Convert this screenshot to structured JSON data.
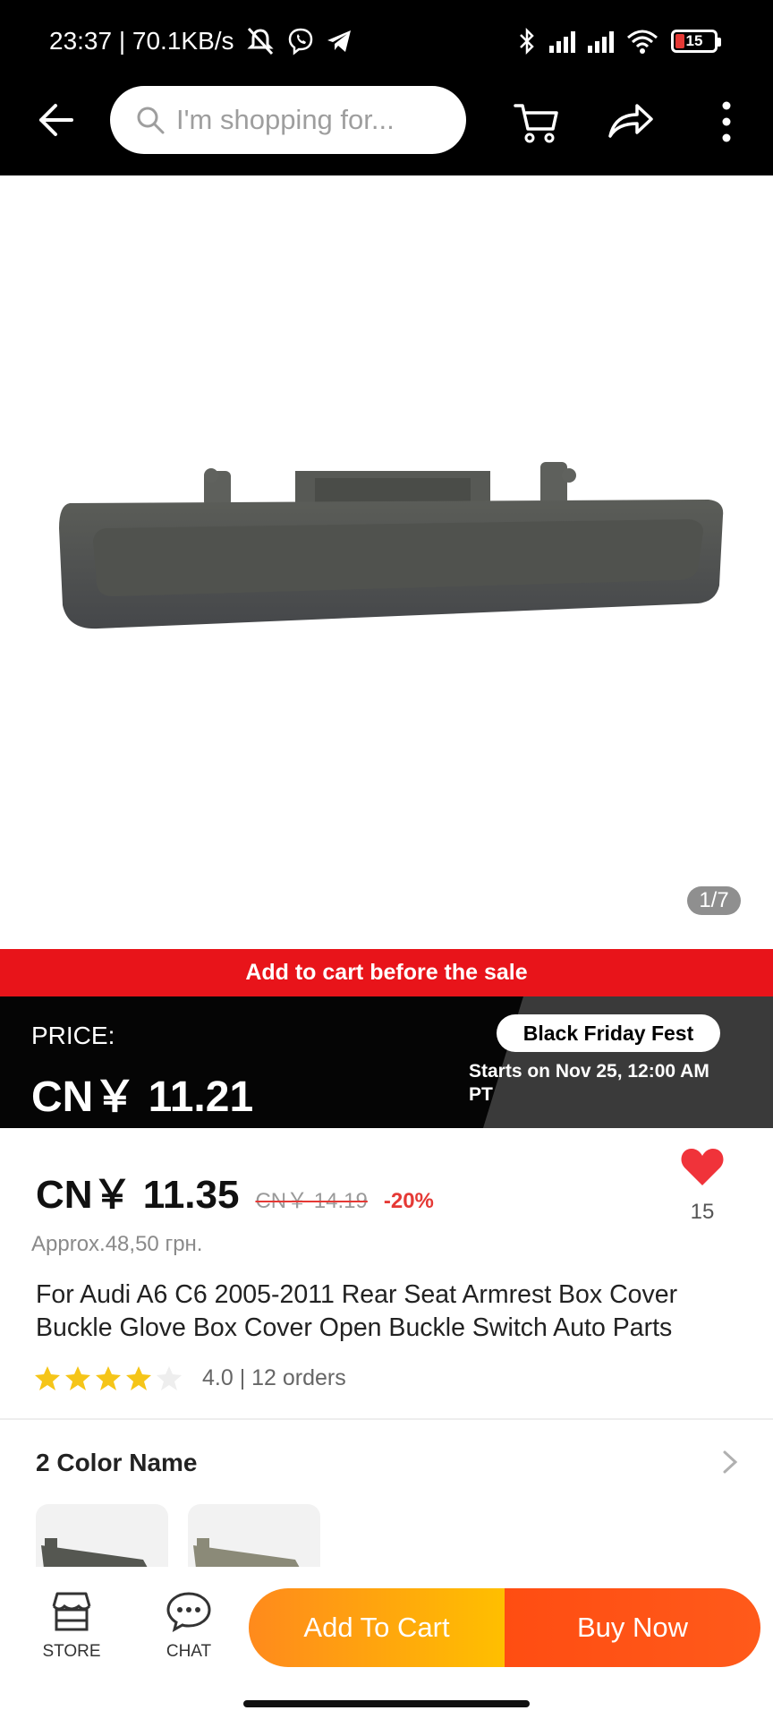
{
  "status_bar": {
    "time_speed": "23:37 | 70.1KB/s",
    "battery": "15"
  },
  "search": {
    "placeholder": "I'm shopping for..."
  },
  "gallery": {
    "counter": "1/7"
  },
  "promo": {
    "banner": "Add to cart before the sale",
    "price_label": "PRICE:",
    "sale_price": "CN￥ 11.21",
    "event_badge": "Black Friday Fest",
    "starts": "Starts on Nov 25, 12:00 AM PT"
  },
  "product": {
    "price": "CN￥ 11.35",
    "old_price": "CN￥ 14.19",
    "discount": "-20%",
    "approx": "Approx.48,50 грн.",
    "wishlist_count": "15",
    "title": "For Audi A6 C6 2005-2011 Rear Seat Armrest Box Cover Buckle Glove Box Cover Open Buckle Switch Auto Parts",
    "rating": 4.0,
    "rating_text": "4.0 | 12 orders"
  },
  "variants": {
    "title": "2 Color Name"
  },
  "bottom_bar": {
    "store": "STORE",
    "chat": "CHAT",
    "add_to_cart": "Add To Cart",
    "buy_now": "Buy Now"
  },
  "colors": {
    "sale_red": "#e8141a",
    "accent_orange": "#ff8a1c",
    "buy_orange": "#ff4d12",
    "star_yellow": "#f5c518"
  }
}
